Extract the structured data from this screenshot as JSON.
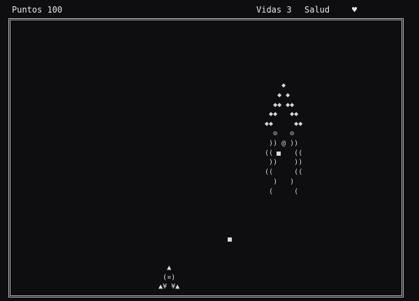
{
  "hud": {
    "score_label": "Puntos 100",
    "lives_label": "Vidas 3",
    "health_label": "Salud",
    "health_icon": "heart-icon",
    "health_glyph": "♥"
  },
  "enemy": {
    "sprite_name": "alien-ship-icon",
    "ascii": "      ◆\n     ◆ ◆\n    ◆◆ ◆◆\n   ◆◆   ◆◆\n  ◆◆     ◆◆\n    ⊙   ⊙\n   )) @ ))\n  ((     ((\n   ))    ))\n  ((     ((\n    )   )\n   (     ("
  },
  "player": {
    "sprite_name": "player-ship-icon",
    "ascii": "    ▲\n   (¤)\n  ▲¥ ¥▲"
  },
  "colors": {
    "background": "#0e0e10",
    "border": "#b9b9b9",
    "text": "#e6e6e6"
  }
}
